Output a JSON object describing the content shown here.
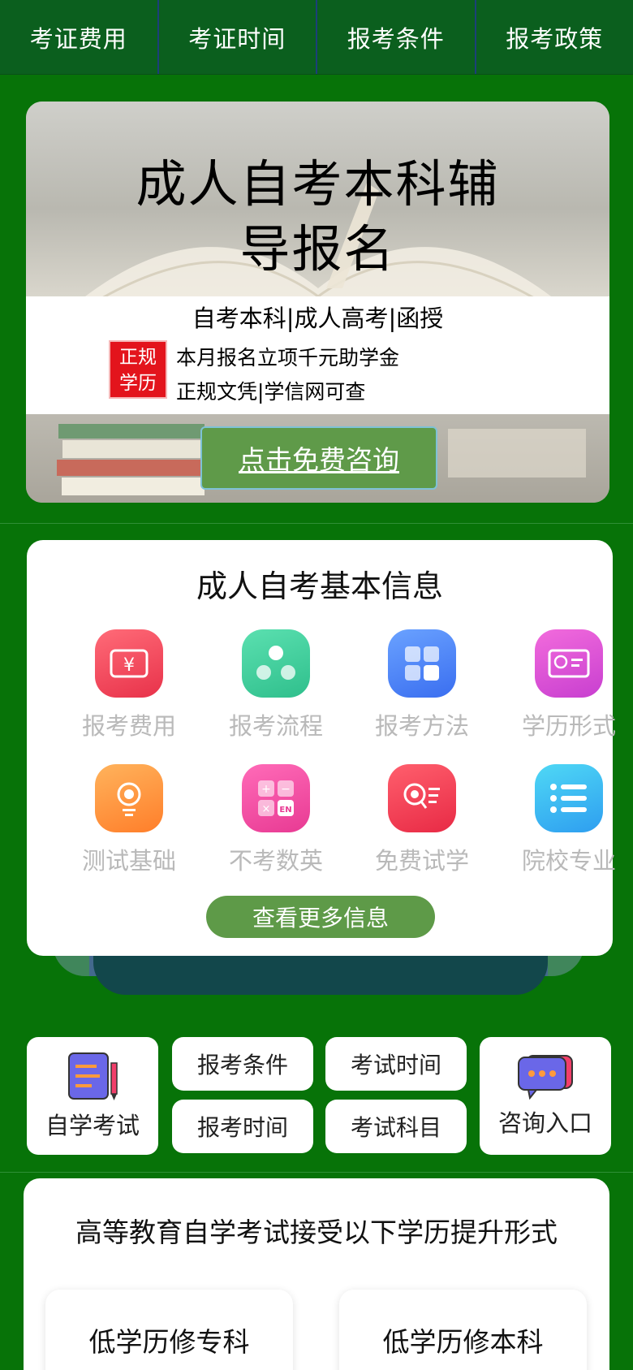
{
  "nav": {
    "items": [
      "考证费用",
      "考证时间",
      "报考条件",
      "报考政策"
    ]
  },
  "banner": {
    "title": "成人自考本科辅导报名",
    "subtitle": "自考本科|成人高考|函授",
    "badge": "正规学历",
    "line1": "本月报名立项千元助学金",
    "line2": "正规文凭|学信网可查",
    "cta": "点击免费咨询"
  },
  "info": {
    "heading": "成人自考基本信息",
    "items": [
      {
        "label": "报考费用",
        "icon": "yen-ticket-icon",
        "color": "#f04b5b"
      },
      {
        "label": "报考流程",
        "icon": "flow-icon",
        "color": "#3ccf9c"
      },
      {
        "label": "报考方法",
        "icon": "grid-icon",
        "color": "#4a86f5"
      },
      {
        "label": "学历形式",
        "icon": "certificate-icon",
        "color": "#e04fcf"
      },
      {
        "label": "测试基础",
        "icon": "lamp-icon",
        "color": "#ff9a3c"
      },
      {
        "label": "不考数英",
        "icon": "calculator-en-icon",
        "color": "#f14ea5"
      },
      {
        "label": "免费试学",
        "icon": "search-list-icon",
        "color": "#f23e55"
      },
      {
        "label": "院校专业",
        "icon": "list-icon",
        "color": "#35b6f2"
      }
    ],
    "more": "查看更多信息"
  },
  "quick": {
    "self_study": "自学考试",
    "consult": "咨询入口",
    "links": [
      "报考条件",
      "考试时间",
      "报考时间",
      "考试科目"
    ]
  },
  "edu": {
    "heading": "高等教育自学考试接受以下学历提升形式",
    "options": [
      "低学历修专科",
      "低学历修本科"
    ]
  }
}
